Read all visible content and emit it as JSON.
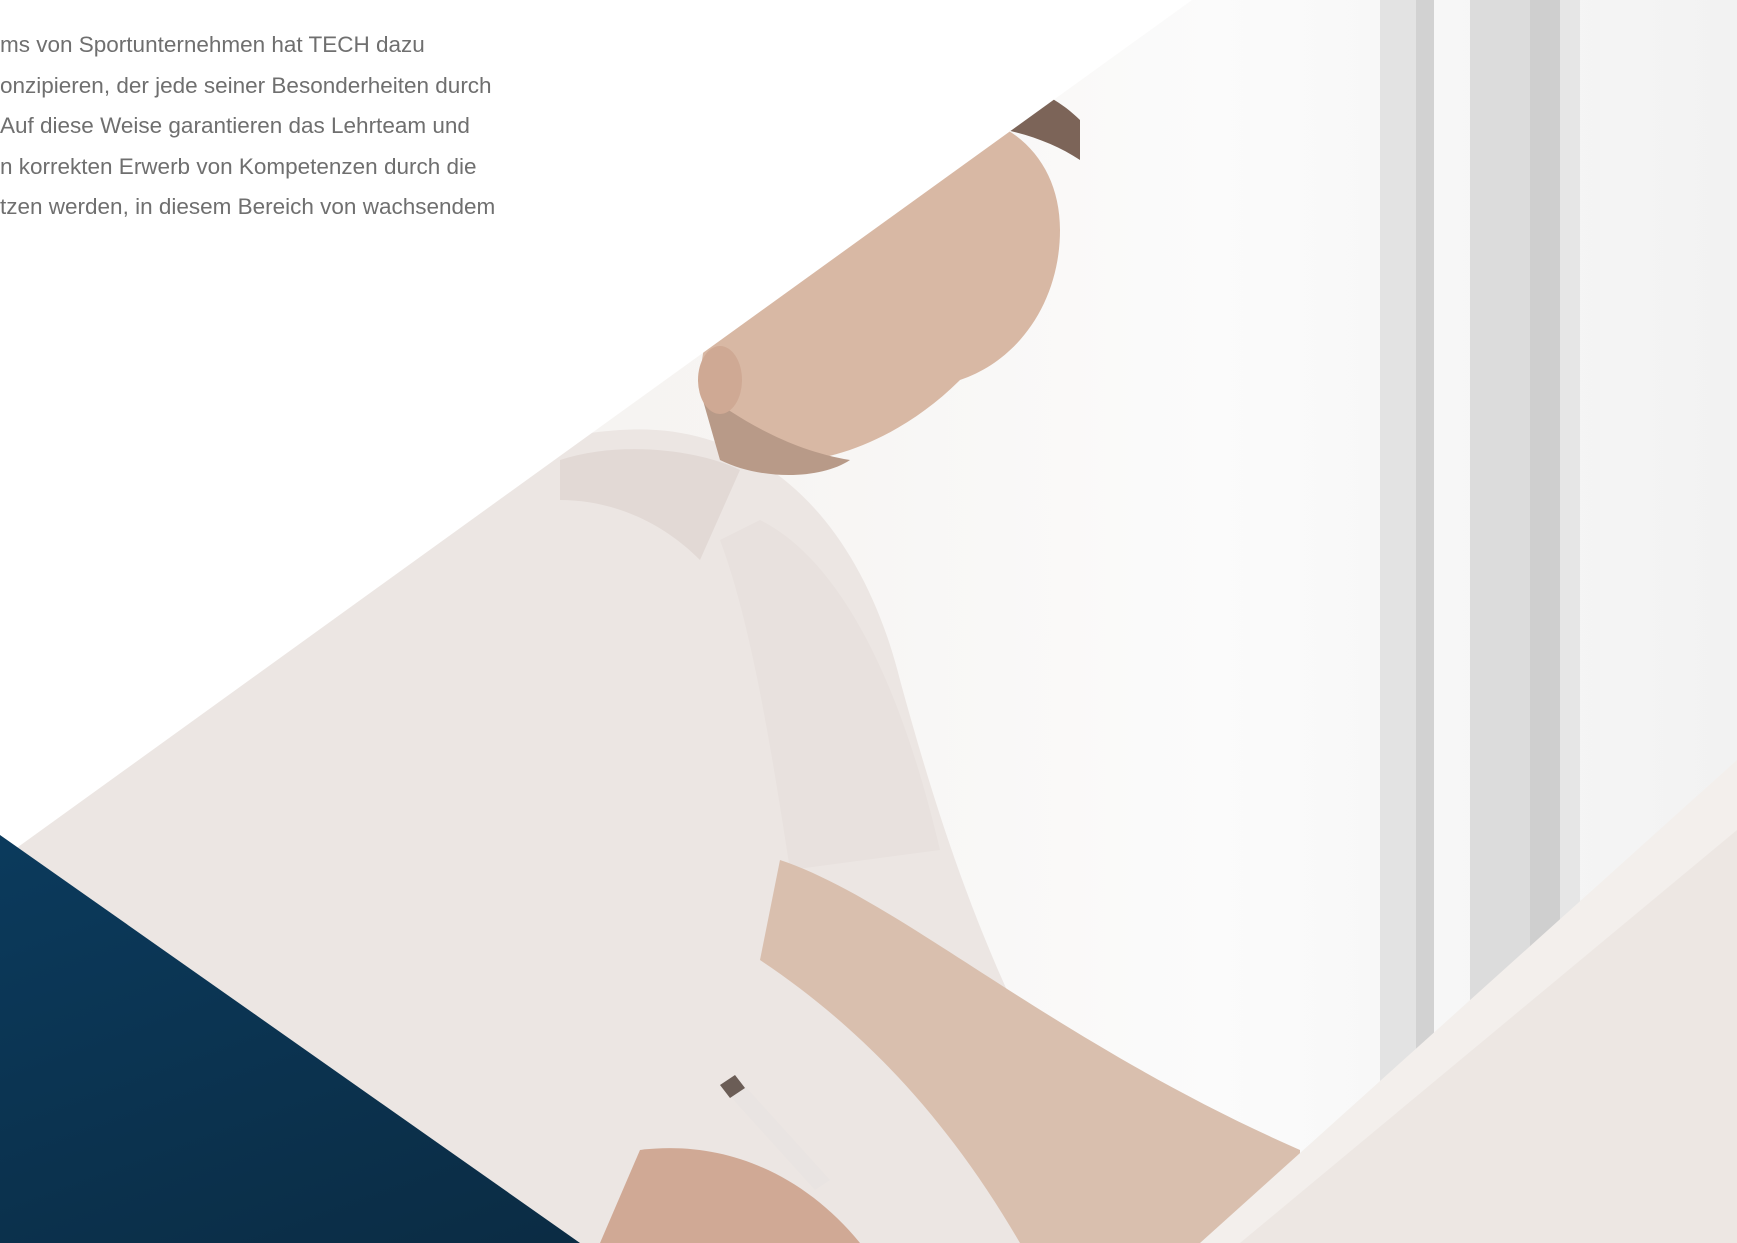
{
  "hero": {
    "paragraph_lines": [
      "ms von Sportunternehmen hat TECH dazu",
      "onzipieren, der jede seiner Besonderheiten durch",
      "Auf diese Weise garantieren das Lehrteam und",
      "n korrekten Erwerb von Kompetenzen durch die",
      "tzen werden, in diesem Bereich von wachsendem"
    ],
    "image": {
      "subject": "man-reading-document",
      "depicts": "man in white polo shirt reading papers and holding a pen near a window"
    }
  },
  "colors": {
    "text": "#6f6f6f",
    "navy_accent": "#0b3a5c",
    "background": "#ffffff"
  }
}
